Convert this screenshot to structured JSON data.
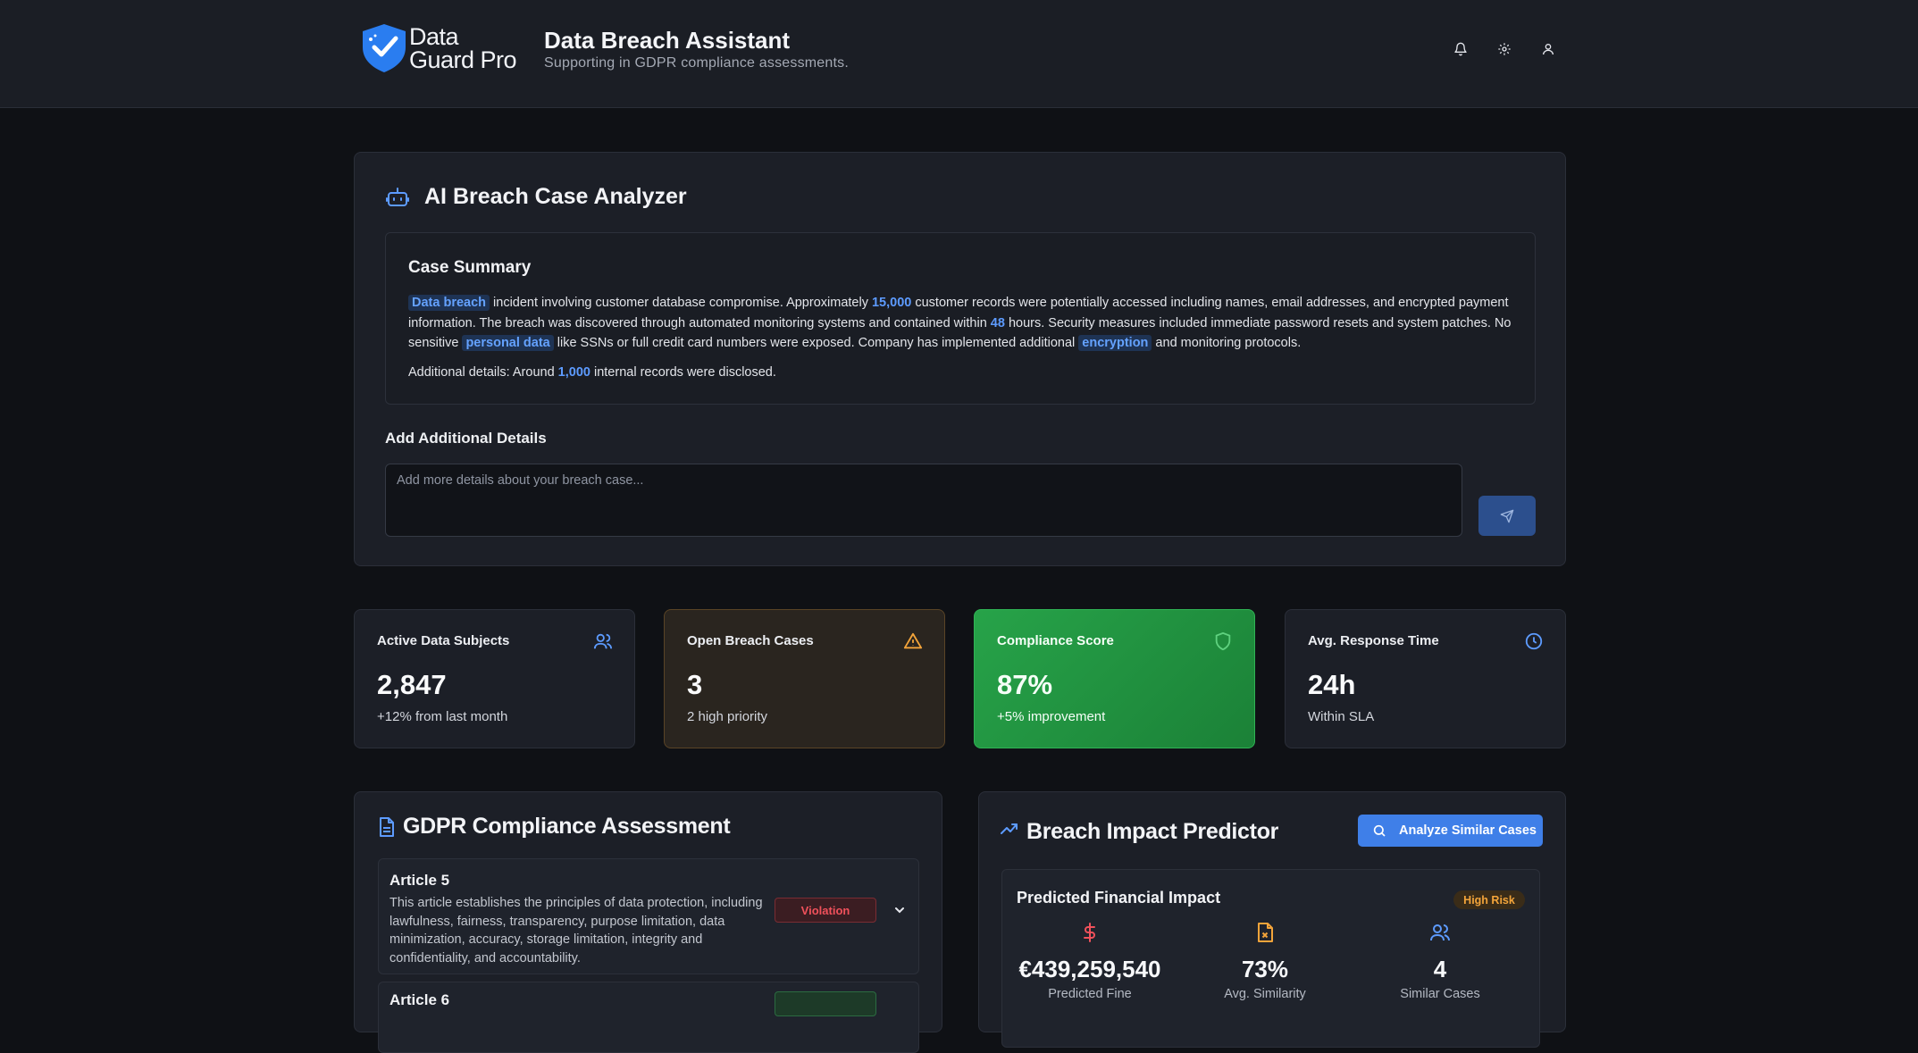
{
  "header": {
    "logo_line1": "Data",
    "logo_line2": "Guard Pro",
    "title": "Data Breach Assistant",
    "subtitle": "Supporting in GDPR compliance assessments.",
    "icons": [
      "bell-icon",
      "gear-icon",
      "user-icon"
    ]
  },
  "analyzer": {
    "title": "AI Breach Case Analyzer",
    "summary_title": "Case Summary",
    "summary": {
      "tag_data_breach": "Data breach",
      "t1": " incident involving customer database compromise. Approximately ",
      "num_records": "15,000",
      "t2": " customer records were potentially accessed including names, email addresses, and encrypted payment information. The breach was discovered through automated monitoring systems and contained within ",
      "num_hours": "48",
      "t3": " hours. Security measures included immediate password resets and system patches. No sensitive ",
      "tag_personal_data": "personal data",
      "t4": " like SSNs or full credit card numbers were exposed. Company has implemented additional ",
      "tag_encryption": "encryption",
      "t5": " and monitoring protocols."
    },
    "extra_prefix": "Additional details: Around ",
    "extra_num": "1,000",
    "extra_suffix": " internal records were disclosed.",
    "add_label": "Add Additional Details",
    "add_placeholder": "Add more details about your breach case...",
    "add_value": ""
  },
  "stats": [
    {
      "label": "Active Data Subjects",
      "value": "2,847",
      "note": "+12% from last month",
      "icon": "users-icon"
    },
    {
      "label": "Open Breach Cases",
      "value": "3",
      "note": "2 high priority",
      "icon": "warning-icon"
    },
    {
      "label": "Compliance Score",
      "value": "87%",
      "note": "+5% improvement",
      "icon": "shield-icon"
    },
    {
      "label": "Avg. Response Time",
      "value": "24h",
      "note": "Within SLA",
      "icon": "clock-icon"
    }
  ],
  "gdpr": {
    "title": "GDPR Compliance Assessment",
    "articles": [
      {
        "title": "Article 5",
        "desc": "This article establishes the principles of data protection, including lawfulness, fairness, transparency, purpose limitation, data minimization, accuracy, storage limitation, integrity and confidentiality, and accountability.",
        "status": "Violation"
      },
      {
        "title": "Article 6",
        "desc": "",
        "status": ""
      }
    ]
  },
  "predictor": {
    "title": "Breach Impact Predictor",
    "analyze_label": "Analyze Similar Cases",
    "impact_title": "Predicted Financial Impact",
    "risk": "High Risk",
    "metrics": [
      {
        "value": "€439,259,540",
        "label": "Predicted Fine",
        "icon": "dollar-icon"
      },
      {
        "value": "73%",
        "label": "Avg. Similarity",
        "icon": "file-x-icon"
      },
      {
        "value": "4",
        "label": "Similar Cases",
        "icon": "users-icon"
      }
    ]
  },
  "colors": {
    "accent": "#3f7fe8",
    "highlight": "#5d9bff",
    "warning": "#f3a43a",
    "danger": "#f0515b",
    "success": "#27a349"
  }
}
